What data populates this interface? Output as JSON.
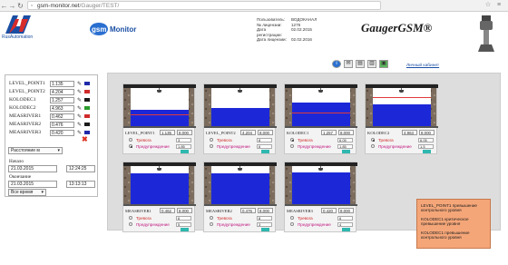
{
  "browser": {
    "url_host": "gsm-monitor.net",
    "url_path": "/Gauger/TEST/"
  },
  "header": {
    "logo_caption": "RusAutomation",
    "gsm_logo": "gsmMonitor",
    "brand": "GaugerGSM®",
    "info": [
      {
        "label": "Пользователь:",
        "value": "ВОДОКАНАЛ"
      },
      {
        "label": "№ лицензии:",
        "value": "1276"
      },
      {
        "label": "Дата регистрации:",
        "value": "02.02.2015"
      },
      {
        "label": "Дата лицензии:",
        "value": "02.02.2016"
      }
    ]
  },
  "toolbar": {
    "icons": [
      "info-icon",
      "mail-icon",
      "table-icon",
      "chart-icon",
      "image-icon"
    ],
    "cabinet_link": "Личный кабинет"
  },
  "sidebar": {
    "sensors": [
      {
        "name": "LEVEL_POINT1",
        "value": "1.135",
        "color": "#1f2aa8"
      },
      {
        "name": "LEVEL_POINT2",
        "value": "4.204",
        "color": "#d02b2b"
      },
      {
        "name": "KOLODEC1",
        "value": "1.257",
        "color": "#1a1a1a"
      },
      {
        "name": "KOLODEC2",
        "value": "4.963",
        "color": "#2a9a2a"
      },
      {
        "name": "MEASRIVER1",
        "value": "0.462",
        "color": "#d02b2b"
      },
      {
        "name": "MEASRIVER2",
        "value": "0.476",
        "color": "#1a1a1a"
      },
      {
        "name": "MEASRIVER3",
        "value": "0.420",
        "color": "#1f2aa8"
      }
    ],
    "mode_select": "Расстояние м",
    "start_label": "Начало",
    "start_date": "21.03.2015",
    "start_time": "12:24:25",
    "end_label": "Окончание",
    "end_date": "21.03.2015",
    "end_time": "13:13:13",
    "range_select": "Все время"
  },
  "tanks": [
    {
      "name": "LEVEL_POINT1",
      "value": "1.135",
      "threshold": "8.000",
      "level": 0.42,
      "alarm": 0.3,
      "alarm_on": false,
      "warn_on": true,
      "small1": "3",
      "small2": "1.85"
    },
    {
      "name": "LEVEL_POINT2",
      "value": "4.204",
      "threshold": "8.000",
      "level": 0.47,
      "alarm": null,
      "alarm_on": false,
      "warn_on": false,
      "small1": "8",
      "small2": "6"
    },
    {
      "name": "KOLODEC1",
      "value": "1.257",
      "threshold": "8.000",
      "level": 0.63,
      "alarm": 0.35,
      "alarm_on": true,
      "warn_on": false,
      "small1": "6.05",
      "small2": "1.85"
    },
    {
      "name": "KOLODEC2",
      "value": "4.963",
      "threshold": "8.000",
      "level": 0.58,
      "alarm": 0.76,
      "alarm_on": true,
      "warn_on": false,
      "small1": "6.05",
      "small2": "1.5"
    },
    {
      "name": "MEASRIVER1",
      "value": "0.462",
      "threshold": "8.000",
      "level": 0.82,
      "alarm": null,
      "alarm_on": false,
      "warn_on": false,
      "small1": "6",
      "small2": "5"
    },
    {
      "name": "MEASRIVER2",
      "value": "0.476",
      "threshold": "8.000",
      "level": 0.82,
      "alarm": null,
      "alarm_on": false,
      "warn_on": false,
      "small1": "8",
      "small2": "3"
    },
    {
      "name": "MEASRIVER3",
      "value": "0.420",
      "threshold": "8.000",
      "level": 0.84,
      "alarm": null,
      "alarm_on": false,
      "warn_on": false,
      "small1": "6",
      "small2": "4"
    }
  ],
  "tank_labels": {
    "alarm": "Тревога",
    "warning": "Предупреждение"
  },
  "notification": [
    "LEVEL_POINT1 превышение контрольного уровня",
    "KOLODEC1 критическое превышение уровня",
    "KOLODEC1 превышение контрольного уровня"
  ]
}
